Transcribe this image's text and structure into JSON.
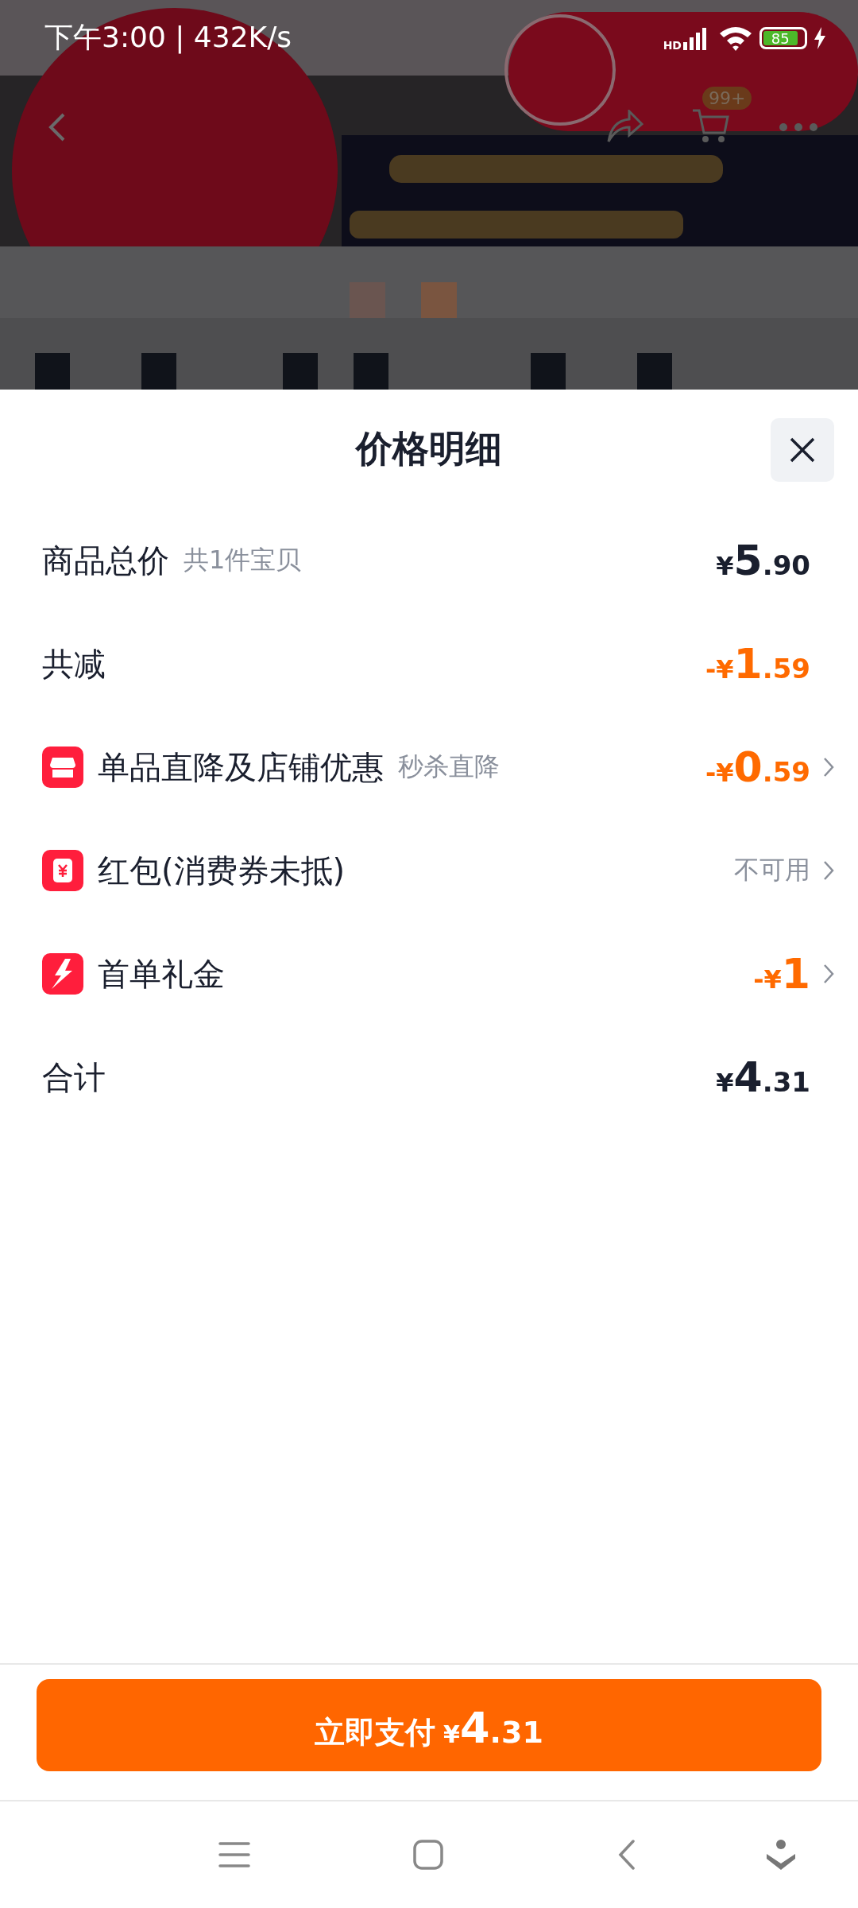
{
  "status_bar": {
    "time": "下午3:00 | 432K/s",
    "network": "HD",
    "battery": "85"
  },
  "background_page": {
    "cart_badge": "99+"
  },
  "sheet": {
    "title": "价格明细",
    "rows": [
      {
        "kind": "plain",
        "label": "商品总价",
        "note": "共1件宝贝",
        "value": {
          "kind": "price",
          "color": "#1a1f2e",
          "prefix": "¥",
          "main": "5",
          "fraction": ".90"
        },
        "chevron": false
      },
      {
        "kind": "plain",
        "label": "共减",
        "value": {
          "kind": "price",
          "color": "#ff6a00",
          "prefix": "-¥",
          "main": "1",
          "fraction": ".59"
        },
        "chevron": false
      },
      {
        "kind": "store",
        "label": "单品直降及店铺优惠",
        "note": "秒杀直降",
        "value": {
          "kind": "price",
          "color": "#ff6a00",
          "prefix": "-¥",
          "main": "0",
          "fraction": ".59"
        },
        "chevron": true
      },
      {
        "kind": "redpacket",
        "label": "红包(消费券未抵)",
        "value": {
          "kind": "text",
          "text": "不可用"
        },
        "chevron": true
      },
      {
        "kind": "bolt",
        "label": "首单礼金",
        "value": {
          "kind": "price",
          "color": "#ff6a00",
          "prefix": "-¥",
          "main": "1"
        },
        "chevron": true
      },
      {
        "kind": "plain",
        "label": "合计",
        "value": {
          "kind": "price",
          "color": "#1a1f2e",
          "prefix": "¥",
          "main": "4",
          "fraction": ".31"
        },
        "chevron": false
      }
    ],
    "pay_button": {
      "label": "立即支付",
      "prefix": "¥",
      "main": "4",
      "fraction": ".31"
    }
  }
}
